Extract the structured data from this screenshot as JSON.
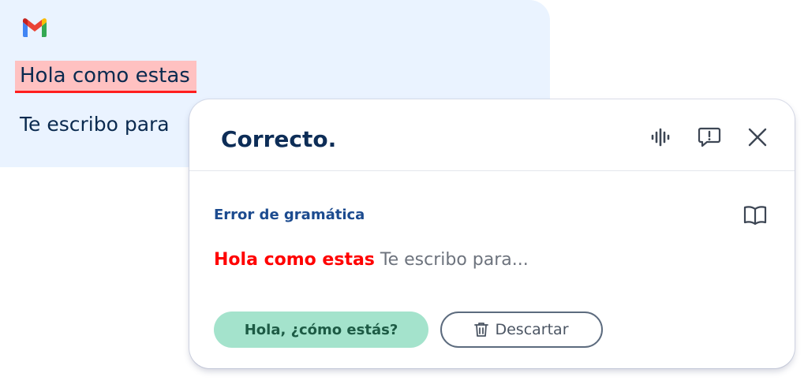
{
  "email": {
    "app_icon": "gmail-logo-icon",
    "subject_text": "Hola como estas",
    "body_text": "Te escribo para"
  },
  "card": {
    "title": "Correcto.",
    "header_icons": [
      "audio-waveform-icon",
      "feedback-icon",
      "close-icon"
    ],
    "section_label": "Error de gramática",
    "section_icon": "book-icon",
    "error_text": "Hola como estas",
    "continuation_text": "Te escribo para...",
    "accept_label": "Hola, ¿cómo estás?",
    "dismiss_label": "Descartar",
    "dismiss_icon": "trash-icon"
  },
  "colors": {
    "email_bg": "#eaf3ff",
    "highlight_bg": "#ffc1c1",
    "error_red": "#ff0000",
    "title_navy": "#0d2d57",
    "label_blue": "#1c4b8f",
    "accept_bg": "#a4e3cc",
    "accept_text": "#1d5b45"
  }
}
